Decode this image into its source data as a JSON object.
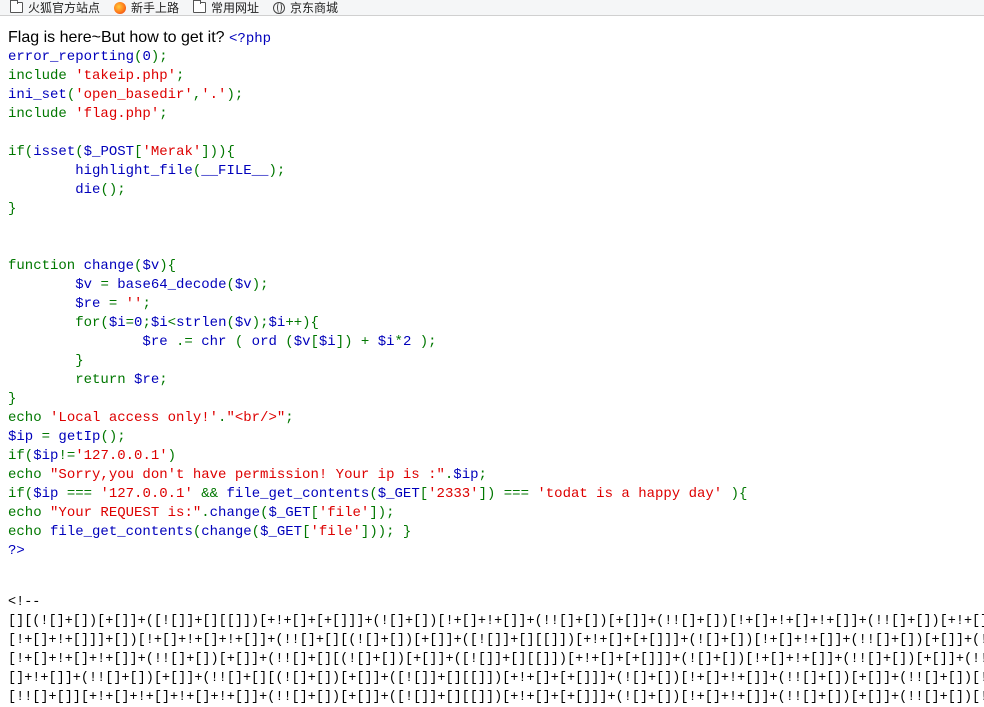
{
  "bookmarks": [
    {
      "icon": "folder-icon",
      "label": "火狐官方站点"
    },
    {
      "icon": "firefox-icon",
      "label": "新手上路"
    },
    {
      "icon": "folder-icon",
      "label": "常用网址"
    },
    {
      "icon": "globe-icon",
      "label": "京东商城"
    }
  ],
  "page": {
    "headline": "Flag is here~But how to get it?",
    "php_open": "<?php",
    "code_lines": [
      [
        [
          "def",
          "error_reporting"
        ],
        [
          "kw",
          "("
        ],
        [
          "def",
          "0"
        ],
        [
          "kw",
          ");"
        ]
      ],
      [
        [
          "kw",
          "include "
        ],
        [
          "str",
          "'takeip.php'"
        ],
        [
          "kw",
          ";"
        ]
      ],
      [
        [
          "def",
          "ini_set"
        ],
        [
          "kw",
          "("
        ],
        [
          "str",
          "'open_basedir'"
        ],
        [
          "kw",
          ","
        ],
        [
          "str",
          "'.'"
        ],
        [
          "kw",
          ");"
        ]
      ],
      [
        [
          "kw",
          "include "
        ],
        [
          "str",
          "'flag.php'"
        ],
        [
          "kw",
          ";"
        ]
      ],
      [],
      [
        [
          "kw",
          "if("
        ],
        [
          "def",
          "isset"
        ],
        [
          "kw",
          "("
        ],
        [
          "def",
          "$_POST"
        ],
        [
          "kw",
          "["
        ],
        [
          "str",
          "'Merak'"
        ],
        [
          "kw",
          "])){"
        ]
      ],
      [
        [
          "def",
          "\thighlight_file"
        ],
        [
          "kw",
          "("
        ],
        [
          "def",
          "__FILE__"
        ],
        [
          "kw",
          ");"
        ]
      ],
      [
        [
          "def",
          "\tdie"
        ],
        [
          "kw",
          "();"
        ]
      ],
      [
        [
          "kw",
          "}"
        ]
      ],
      [],
      [],
      [
        [
          "kw",
          "function "
        ],
        [
          "def",
          "change"
        ],
        [
          "kw",
          "("
        ],
        [
          "def",
          "$v"
        ],
        [
          "kw",
          "){"
        ]
      ],
      [
        [
          "def",
          "\t$v "
        ],
        [
          "kw",
          "= "
        ],
        [
          "def",
          "base64_decode"
        ],
        [
          "kw",
          "("
        ],
        [
          "def",
          "$v"
        ],
        [
          "kw",
          ");"
        ]
      ],
      [
        [
          "def",
          "\t$re "
        ],
        [
          "kw",
          "= "
        ],
        [
          "str",
          "''"
        ],
        [
          "kw",
          ";"
        ]
      ],
      [
        [
          "kw",
          "\tfor("
        ],
        [
          "def",
          "$i"
        ],
        [
          "kw",
          "="
        ],
        [
          "def",
          "0"
        ],
        [
          "kw",
          ";"
        ],
        [
          "def",
          "$i"
        ],
        [
          "kw",
          "<"
        ],
        [
          "def",
          "strlen"
        ],
        [
          "kw",
          "("
        ],
        [
          "def",
          "$v"
        ],
        [
          "kw",
          ");"
        ],
        [
          "def",
          "$i"
        ],
        [
          "kw",
          "++){"
        ]
      ],
      [
        [
          "def",
          "\t\t$re "
        ],
        [
          "kw",
          ".= "
        ],
        [
          "def",
          "chr "
        ],
        [
          "kw",
          "( "
        ],
        [
          "def",
          "ord "
        ],
        [
          "kw",
          "("
        ],
        [
          "def",
          "$v"
        ],
        [
          "kw",
          "["
        ],
        [
          "def",
          "$i"
        ],
        [
          "kw",
          "]) + "
        ],
        [
          "def",
          "$i"
        ],
        [
          "kw",
          "*"
        ],
        [
          "def",
          "2 "
        ],
        [
          "kw",
          ");"
        ]
      ],
      [
        [
          "kw",
          "\t}"
        ]
      ],
      [
        [
          "kw",
          "\treturn "
        ],
        [
          "def",
          "$re"
        ],
        [
          "kw",
          ";"
        ]
      ],
      [
        [
          "kw",
          "}"
        ]
      ],
      [
        [
          "kw",
          "echo "
        ],
        [
          "str",
          "'Local access only!'"
        ],
        [
          "kw",
          "."
        ],
        [
          "str",
          "\"<br/>\""
        ],
        [
          "kw",
          ";"
        ]
      ],
      [
        [
          "def",
          "$ip "
        ],
        [
          "kw",
          "= "
        ],
        [
          "def",
          "getIp"
        ],
        [
          "kw",
          "();"
        ]
      ],
      [
        [
          "kw",
          "if("
        ],
        [
          "def",
          "$ip"
        ],
        [
          "kw",
          "!="
        ],
        [
          "str",
          "'127.0.0.1'"
        ],
        [
          "kw",
          ")"
        ]
      ],
      [
        [
          "kw",
          "echo "
        ],
        [
          "str",
          "\"Sorry,you don't have permission! Your ip is :\""
        ],
        [
          "kw",
          "."
        ],
        [
          "def",
          "$ip"
        ],
        [
          "kw",
          ";"
        ]
      ],
      [
        [
          "kw",
          "if("
        ],
        [
          "def",
          "$ip "
        ],
        [
          "kw",
          "=== "
        ],
        [
          "str",
          "'127.0.0.1' "
        ],
        [
          "kw",
          "&& "
        ],
        [
          "def",
          "file_get_contents"
        ],
        [
          "kw",
          "("
        ],
        [
          "def",
          "$_GET"
        ],
        [
          "kw",
          "["
        ],
        [
          "str",
          "'2333'"
        ],
        [
          "kw",
          "]) === "
        ],
        [
          "str",
          "'todat is a happy day' "
        ],
        [
          "kw",
          "){"
        ]
      ],
      [
        [
          "kw",
          "echo "
        ],
        [
          "str",
          "\"Your REQUEST is:\""
        ],
        [
          "kw",
          "."
        ],
        [
          "def",
          "change"
        ],
        [
          "kw",
          "("
        ],
        [
          "def",
          "$_GET"
        ],
        [
          "kw",
          "["
        ],
        [
          "str",
          "'file'"
        ],
        [
          "kw",
          "]);"
        ]
      ],
      [
        [
          "kw",
          "echo "
        ],
        [
          "def",
          "file_get_contents"
        ],
        [
          "kw",
          "("
        ],
        [
          "def",
          "change"
        ],
        [
          "kw",
          "("
        ],
        [
          "def",
          "$_GET"
        ],
        [
          "kw",
          "["
        ],
        [
          "str",
          "'file'"
        ],
        [
          "kw",
          "])); }"
        ]
      ],
      [
        [
          "tag",
          "?>"
        ]
      ]
    ],
    "comment_open": "<!--",
    "jsfuck_lines": [
      "[][(![]+[])[+[]]+([![]]+[][[]])[+!+[]+[+[]]]+(![]+[])[!+[]+!+[]]+(!![]+[])[+[]]+(!![]+[])[!+[]+!+[]+!+[]]+(!![]+[])[+!+[]]][([][(![]+[])[+[]]+([![]]+[][[]])[+!+[]+[+[]]]+(![]+[])[!+[]+!+[]]+(!![]+[])[+[]]+(!![]+[])[!+[]+!+[]+!+[]]+(!![]+[])[+!+[]]]+[])[!+[]+!+[]+!+[]]",
      "[!+[]+!+[]]]+[])[!+[]+!+[]+!+[]]+(!![]+[][(![]+[])[+[]]+([![]]+[][[]])[+!+[]+[+[]]]+(![]+[])[!+[]+!+[]]+(!![]+[])[+[]]+(!![]+[])[!+[]+!+[]+!+[]]+(!![]+[])[+!+[]]])[+!+[]+[+[]]]+([][[]]+[])[+!+[]]+(![]+[])[!+[]+!+[]+!+[]]+(!![]+[])[+[]]",
      "[!+[]+!+[]+!+[]]+(!![]+[])[+[]]+(!![]+[][(![]+[])[+[]]+([![]]+[][[]])[+!+[]+[+[]]]+(![]+[])[!+[]+!+[]]+(!![]+[])[+[]]+(!![]+[])[!+[]+!+[]+!+[]]+(!![]+[])[+!+[]]])[+!+[]+[+[]]]+(!![]+[])[+!+[]]]+([][[]]+[])[+!+[]]+(![]+[])[+!+[]]",
      "[]+!+[]]+(!![]+[])[+[]]+(!![]+[][(![]+[])[+[]]+([![]]+[][[]])[+!+[]+[+[]]]+(![]+[])[!+[]+!+[]]+(!![]+[])[+[]]+(!![]+[])[!+[]+!+[]+!+[]]+(!![]+[])[+!+[]]])[+!+[]+[+[]]]+(!![]+[])[+!+[]]]+([][[]]+[])[+!+[]]+(![]+[])[!+[]+!+[]]",
      "[!![]+[]][+!+[]+!+[]+!+[]+!+[]]+(!![]+[])[+[]]+([![]]+[][[]])[+!+[]+[+[]]]+(![]+[])[!+[]+!+[]]+(!![]+[])[+[]]+(!![]+[])[!+[]+!+[]+!+[]]+(!![]+[])[+!+[]]+([][[]]+[])[+!+[]]+(![]+[])[!+[]+!+[]+!+[]]+(!![]+[])[+[]]+(!![]+[])[+!+[]]"
    ]
  }
}
